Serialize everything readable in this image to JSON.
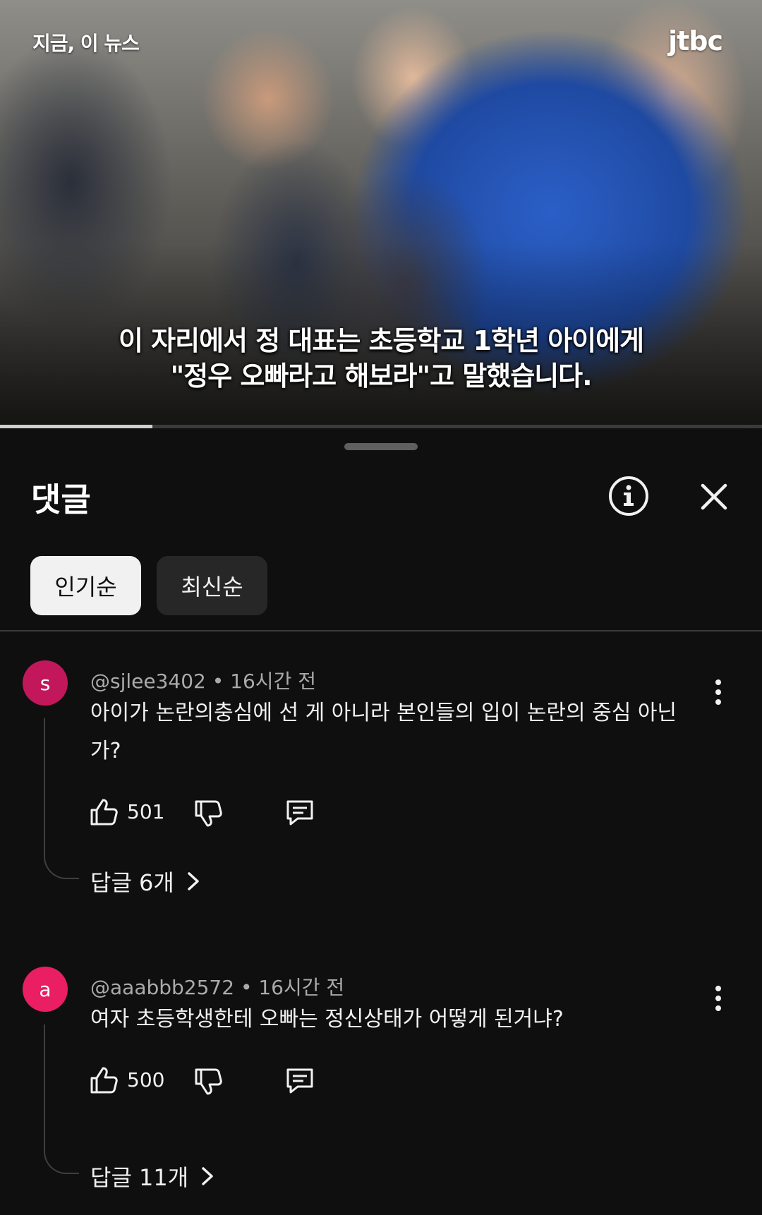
{
  "video": {
    "label": "지금, 이 뉴스",
    "logo": "jtbc",
    "subtitle_line1": "이 자리에서 정 대표는 초등학교 1학년 아이에게",
    "subtitle_line2": "\"정우 오빠라고 해보라\"고 말했습니다.",
    "progress": 0.2
  },
  "sheet": {
    "title": "댓글",
    "info_icon": "info-icon",
    "close_icon": "close-icon"
  },
  "sort": {
    "popular": "인기순",
    "recent": "최신순",
    "selected": "인기순"
  },
  "comments": [
    {
      "avatar_letter": "s",
      "avatar_color": "#c2185b",
      "meta": "@sjlee3402 • 16시간 전",
      "text": "아이가 논란의충심에 선 게 아니라  본인들의 입이 논란의 중심 아닌가?",
      "likes": "501",
      "replies": "답글 6개"
    },
    {
      "avatar_letter": "a",
      "avatar_color": "#e91e63",
      "meta": "@aaabbb2572 • 16시간 전",
      "text": "여자 초등학생한테 오빠는 정신상태가 어떻게 된거냐?",
      "likes": "500",
      "replies": "답글 11개"
    }
  ]
}
